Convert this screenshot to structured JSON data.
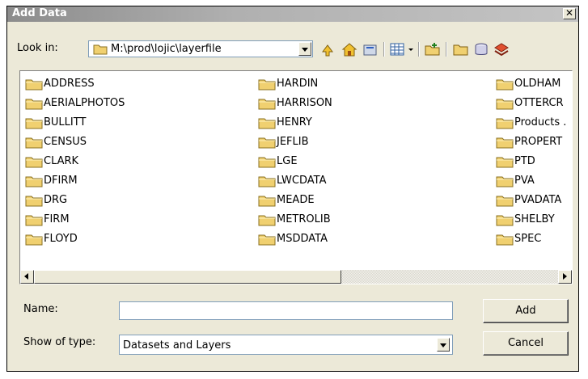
{
  "window": {
    "title": "Add Data",
    "close_glyph": "✕"
  },
  "toolbar": {
    "look_in_label": "Look in:",
    "look_in_value": "M:\\prod\\lojic\\layerfile",
    "buttons": [
      "up-one-level-icon",
      "home-icon",
      "catalog-icon",
      "view-menu-icon",
      "connect-folder-icon",
      "new-folder-icon",
      "new-geodatabase-icon",
      "new-layer-icon"
    ]
  },
  "file_list": {
    "columns": [
      [
        "ADDRESS",
        "AERIALPHOTOS",
        "BULLITT",
        "CENSUS",
        "CLARK",
        "DFIRM",
        "DRG",
        "FIRM",
        "FLOYD"
      ],
      [
        "HARDIN",
        "HARRISON",
        "HENRY",
        "JEFLIB",
        "LGE",
        "LWCDATA",
        "MEADE",
        "METROLIB",
        "MSDDATA"
      ],
      [
        "OLDHAM",
        "OTTERCR",
        "Products .",
        "PROPERT",
        "PTD",
        "PVA",
        "PVADATA",
        "SHELBY",
        "SPEC"
      ]
    ]
  },
  "form": {
    "name_label": "Name:",
    "name_value": "",
    "type_label": "Show of type:",
    "type_value": "Datasets and Layers"
  },
  "buttons": {
    "add": "Add",
    "cancel": "Cancel"
  },
  "colors": {
    "folder": "#f0d070",
    "dialog_bg": "#ece9d8"
  }
}
